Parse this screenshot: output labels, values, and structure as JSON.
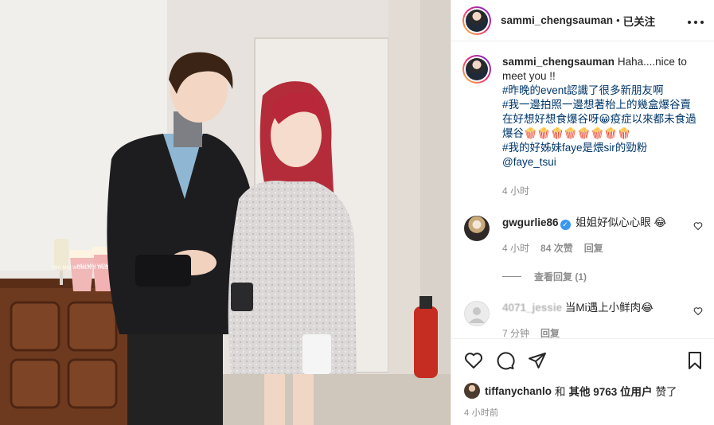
{
  "header": {
    "username": "sammi_chengsauman",
    "separator": "•",
    "follow_status": "已关注",
    "more": "···"
  },
  "caption": {
    "username": "sammi_chengsauman",
    "lines": [
      "Haha....nice to meet you !!",
      "#昨晚的event認識了很多新朋友啊",
      "#我一邊拍照一邊想著枱上的幾盒爆谷賣在好想好想食爆谷呀😀疫症以來都未食過爆谷🍿🍿🍿🍿🍿🍿🍿🍿",
      "#我的好姊妹faye是煨sir的勁粉",
      "@faye_tsui"
    ],
    "time": "4 小时"
  },
  "comments": [
    {
      "username": "gwgurlie86",
      "verified": true,
      "text": "姐姐好似心心眼 😂",
      "time": "4 小时",
      "likes": "84 次赞",
      "reply": "回复",
      "view_replies": "查看回复 (1)"
    },
    {
      "username": "4071_jessie",
      "text": "当Mi遇上小鲜肉😂",
      "time": "7 分钟",
      "reply": "回复"
    }
  ],
  "likes": {
    "user": "tiffanychanlo",
    "joiner": "和",
    "others_label": "其他 9763 位用户",
    "suffix": "赞了"
  },
  "post_time": "4 小时前",
  "photo": {
    "popcorn_box_text_1": "MIU MIU WOMEN'S TALES",
    "popcorn_box_text_2": "MIU MIU WOMEN'S TALES"
  },
  "icons": {
    "like": "heart-icon",
    "comment": "comment-icon",
    "share": "share-icon",
    "save": "bookmark-icon",
    "more": "more-icon",
    "verified": "verified-badge-icon"
  },
  "colors": {
    "link": "#00376b",
    "muted": "#8e8e8e",
    "verified": "#3897f0"
  }
}
